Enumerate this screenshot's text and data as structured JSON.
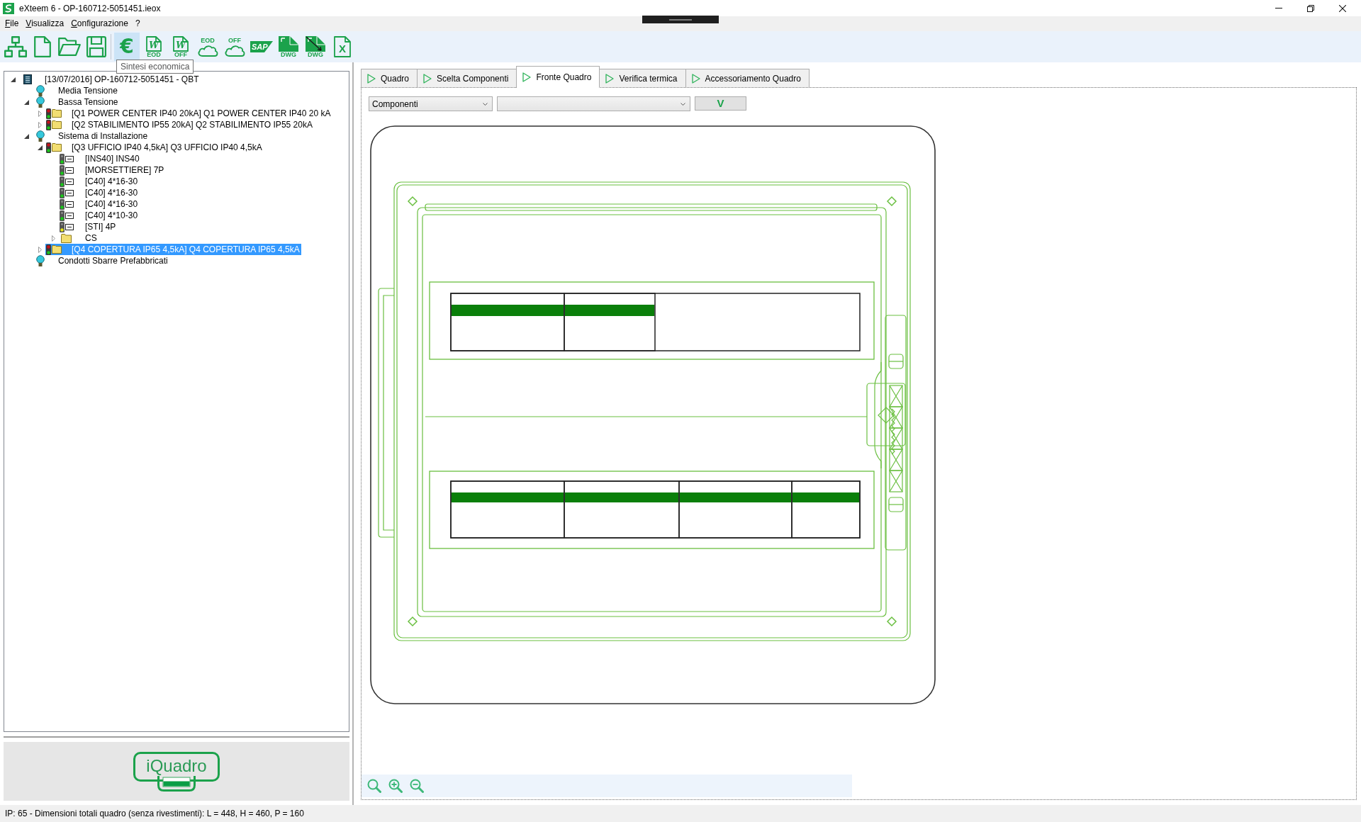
{
  "window": {
    "title": "eXteem 6 - OP-160712-5051451.ieox"
  },
  "menu": [
    "File",
    "Visualizza",
    "Configurazione",
    "?"
  ],
  "toolbar": {
    "buttons": [
      {
        "kind": "hierarchy",
        "hovered": false
      },
      {
        "kind": "new",
        "hovered": false
      },
      {
        "kind": "open",
        "hovered": false
      },
      {
        "kind": "save",
        "hovered": false
      },
      {
        "kind": "separator"
      },
      {
        "kind": "euro",
        "glyph": "€",
        "hovered": true,
        "tooltip": "Sintesi economica"
      },
      {
        "kind": "word",
        "letter": "W",
        "caption": "EOD",
        "hovered": false
      },
      {
        "kind": "word",
        "letter": "W",
        "caption": "OFF",
        "hovered": false
      },
      {
        "kind": "cloud",
        "caption": "EOD",
        "hovered": false
      },
      {
        "kind": "cloud",
        "caption": "OFF",
        "hovered": false
      },
      {
        "kind": "sap",
        "caption": "SAP",
        "hovered": false
      },
      {
        "kind": "dwg",
        "caption": "DWG",
        "hovered": false
      },
      {
        "kind": "dwg_line",
        "caption": "DWG",
        "hovered": false
      },
      {
        "kind": "excel",
        "letter": "X",
        "hovered": false
      }
    ]
  },
  "tree": [
    {
      "kind": "root",
      "label": "[13/07/2016] OP-160712-5051451 - QBT",
      "expanded": true,
      "selected": false,
      "children": [
        {
          "kind": "category",
          "label": "Media Tensione",
          "selected": false
        },
        {
          "kind": "category",
          "label": "Bassa Tensione",
          "expanded": true,
          "selected": false,
          "children": [
            {
              "kind": "switchboard",
              "label": "[Q1 POWER CENTER IP40 20kA] Q1 POWER CENTER IP40 20 kA",
              "expanded": false,
              "selected": false
            },
            {
              "kind": "switchboard",
              "label": "[Q2 STABILIMENTO IP55 20kA] Q2 STABILIMENTO IP55 20kA",
              "expanded": false,
              "selected": false
            }
          ]
        },
        {
          "kind": "category",
          "label": "Sistema di Installazione",
          "expanded": true,
          "selected": false,
          "children": [
            {
              "kind": "switchboard",
              "label": "[Q3 UFFICIO IP40 4,5kA] Q3 UFFICIO IP40 4,5kA",
              "expanded": true,
              "selected": false,
              "children": [
                {
                  "kind": "component",
                  "label": "[INS40] INS40",
                  "color": "#19c819",
                  "selected": false
                },
                {
                  "kind": "component",
                  "label": "[MORSETTIERE] 7P",
                  "color": "#19c819",
                  "selected": false
                },
                {
                  "kind": "component",
                  "label": "[C40] 4*16-30",
                  "color": "#19c819",
                  "selected": false
                },
                {
                  "kind": "component",
                  "label": "[C40] 4*16-30",
                  "color": "#19c819",
                  "selected": false
                },
                {
                  "kind": "component",
                  "label": "[C40] 4*16-30",
                  "color": "#19c819",
                  "selected": false
                },
                {
                  "kind": "component",
                  "label": "[C40] 4*10-30",
                  "color": "#19c819",
                  "selected": false
                },
                {
                  "kind": "component",
                  "label": "[STI] 4P",
                  "color": "#e6e619",
                  "selected": false
                },
                {
                  "kind": "folder",
                  "label": "CS",
                  "expanded": false,
                  "selected": false
                }
              ]
            },
            {
              "kind": "switchboard",
              "label": "[Q4 COPERTURA IP65 4,5kA] Q4 COPERTURA IP65 4,5kA",
              "expanded": false,
              "selected": true
            }
          ]
        },
        {
          "kind": "category",
          "label": "Condotti Sbarre Prefabbricati",
          "selected": false
        }
      ]
    }
  ],
  "logo": {
    "text": "iQuadro"
  },
  "tabs": [
    {
      "label": "Quadro",
      "selected": false
    },
    {
      "label": "Scelta Componenti",
      "selected": false
    },
    {
      "label": "Fronte Quadro",
      "selected": true
    },
    {
      "label": "Verifica termica",
      "selected": false
    },
    {
      "label": "Accessoriamento Quadro",
      "selected": false
    }
  ],
  "filters": {
    "select": {
      "value": "Componenti"
    },
    "apply_button": {
      "label": "V"
    }
  },
  "zoom_tools": [
    {
      "kind": "fit"
    },
    {
      "kind": "zoom_in"
    },
    {
      "kind": "zoom_out"
    }
  ],
  "status_bar": {
    "text": "IP: 65 - Dimensioni totali quadro (senza rivestimenti): L = 448, H = 460, P = 160"
  }
}
